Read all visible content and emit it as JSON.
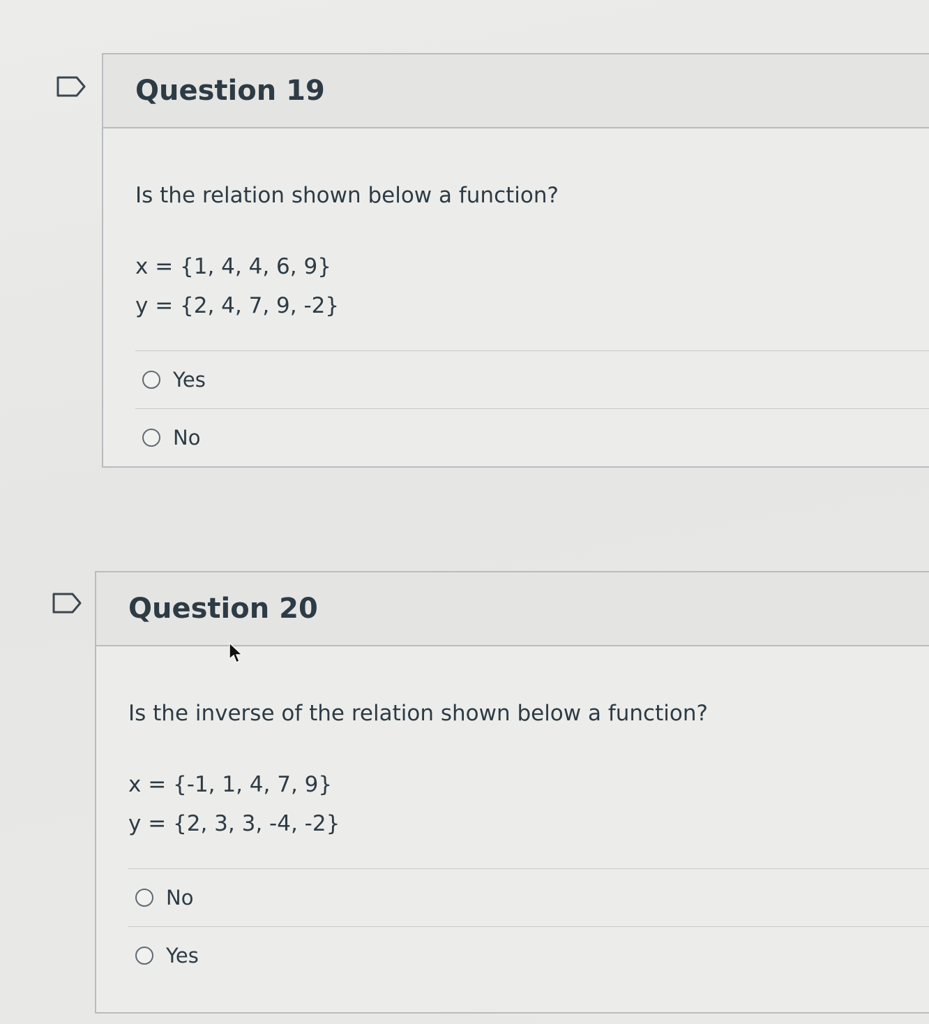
{
  "questions": [
    {
      "title": "Question 19",
      "prompt": "Is the relation shown below a function?",
      "x_line": "x = {1, 4, 4, 6, 9}",
      "y_line": "y = {2, 4, 7, 9, -2}",
      "answers": [
        {
          "label": "Yes",
          "selected": false
        },
        {
          "label": "No",
          "selected": false
        }
      ],
      "flag_icon": "flag-outline-icon"
    },
    {
      "title": "Question 20",
      "prompt": "Is the inverse of the relation shown below a function?",
      "x_line": "x = {-1, 1, 4, 7, 9}",
      "y_line": "y = {2, 3, 3, -4, -2}",
      "answers": [
        {
          "label": "No",
          "selected": false
        },
        {
          "label": "Yes",
          "selected": false
        }
      ],
      "flag_icon": "flag-outline-icon"
    }
  ],
  "colors": {
    "text": "#2d3b45",
    "border": "#b9bcbf",
    "header_bg": "#e4e5e3"
  }
}
